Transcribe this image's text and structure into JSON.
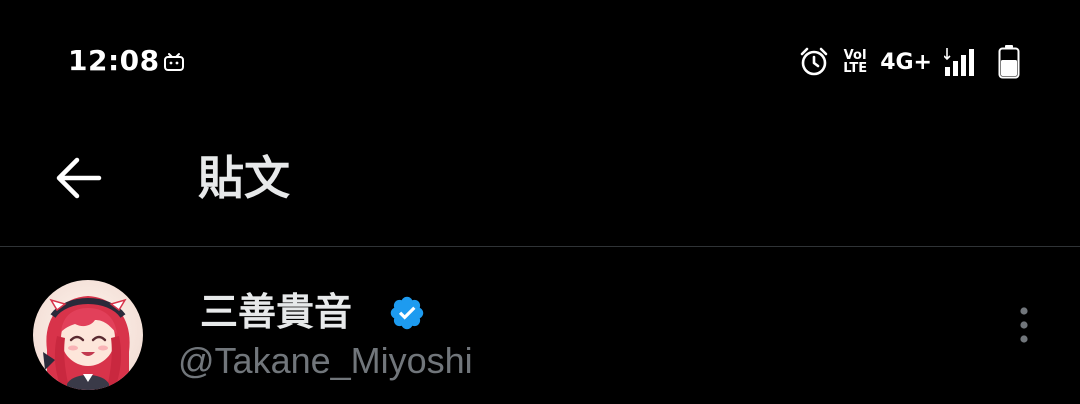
{
  "status_bar": {
    "time": "12:08",
    "app_icon": "bilibili-icon",
    "alarm_icon": "alarm-icon",
    "volte_top": "VoI",
    "volte_bottom": "LTE",
    "network_type": "4G+",
    "signal_icon": "signal-bars-icon",
    "battery_icon": "battery-icon"
  },
  "header": {
    "back_icon": "back-arrow-icon",
    "title": "貼文"
  },
  "post": {
    "author": {
      "display_name": "三善貴音",
      "verified_icon": "verified-badge-icon",
      "username": "@Takane_Miyoshi",
      "avatar_icon": "avatar"
    },
    "more_icon": "more-vertical-icon"
  },
  "colors": {
    "background": "#000000",
    "primary_text": "#e7e9ea",
    "secondary_text": "#71767b",
    "divider": "#2f3336",
    "verified": "#1d9bf0"
  }
}
